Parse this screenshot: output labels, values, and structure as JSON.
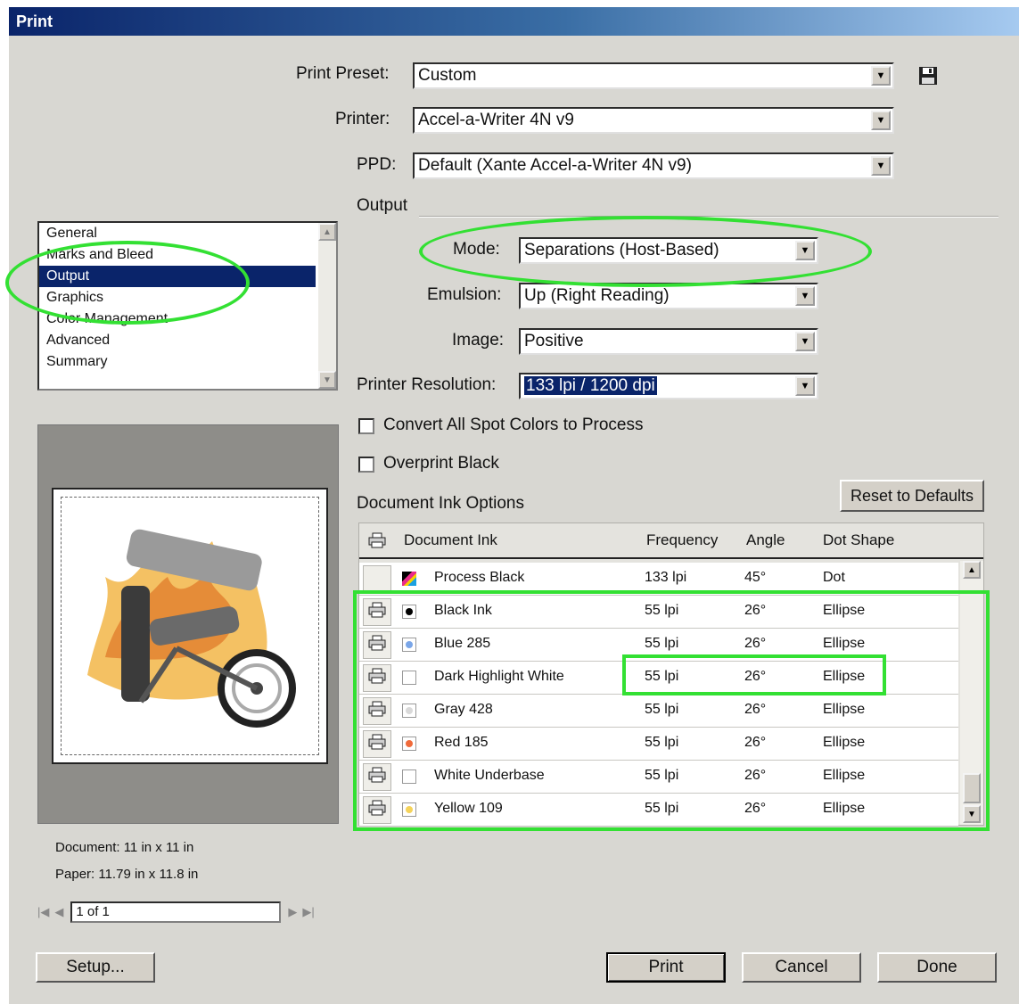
{
  "window": {
    "title": "Print"
  },
  "preset": {
    "label": "Print Preset:",
    "value": "Custom"
  },
  "printer": {
    "label": "Printer:",
    "value": "Accel-a-Writer 4N v9"
  },
  "ppd": {
    "label": "PPD:",
    "value": "Default (Xante Accel-a-Writer 4N v9)"
  },
  "output": {
    "section_title": "Output",
    "mode": {
      "label": "Mode:",
      "value": "Separations (Host-Based)"
    },
    "emulsion": {
      "label": "Emulsion:",
      "value": "Up (Right Reading)"
    },
    "image": {
      "label": "Image:",
      "value": "Positive"
    },
    "resolution": {
      "label": "Printer Resolution:",
      "value": "133 lpi / 1200 dpi"
    },
    "convert_spot": {
      "label": "Convert All Spot Colors to Process",
      "checked": false
    },
    "overprint_black": {
      "label": "Overprint Black",
      "checked": false
    }
  },
  "categories": {
    "items": [
      {
        "label": "General"
      },
      {
        "label": "Marks and Bleed"
      },
      {
        "label": "Output"
      },
      {
        "label": "Graphics"
      },
      {
        "label": "Color Management"
      },
      {
        "label": "Advanced"
      },
      {
        "label": "Summary"
      }
    ],
    "selected": "Output"
  },
  "preview": {
    "document_size": "Document: 11 in x 11 in",
    "paper_size": "Paper: 11.79 in x 11.8 in",
    "page_field": "1 of 1"
  },
  "ink_options": {
    "section_title": "Document Ink Options",
    "reset_label": "Reset to Defaults",
    "columns": {
      "ink": "Document Ink",
      "frequency": "Frequency",
      "angle": "Angle",
      "dot_shape": "Dot Shape"
    },
    "rows": [
      {
        "name": "Process Black",
        "frequency": "133 lpi",
        "angle": "45°",
        "dot_shape": "Dot",
        "swatch": "process",
        "print": false
      },
      {
        "name": "Black Ink",
        "frequency": "55 lpi",
        "angle": "26°",
        "dot_shape": "Ellipse",
        "swatch": "#000000",
        "print": true
      },
      {
        "name": "Blue 285",
        "frequency": "55 lpi",
        "angle": "26°",
        "dot_shape": "Ellipse",
        "swatch": "#7aa6e8",
        "print": true
      },
      {
        "name": "Dark Highlight White",
        "frequency": "55 lpi",
        "angle": "26°",
        "dot_shape": "Ellipse",
        "swatch": "#ffffff",
        "print": true
      },
      {
        "name": "Gray 428",
        "frequency": "55 lpi",
        "angle": "26°",
        "dot_shape": "Ellipse",
        "swatch": "#d9d9d9",
        "print": true
      },
      {
        "name": "Red 185",
        "frequency": "55 lpi",
        "angle": "26°",
        "dot_shape": "Ellipse",
        "swatch": "#f06a3a",
        "print": true
      },
      {
        "name": "White Underbase",
        "frequency": "55 lpi",
        "angle": "26°",
        "dot_shape": "Ellipse",
        "swatch": "#ffffff",
        "print": true
      },
      {
        "name": "Yellow 109",
        "frequency": "55 lpi",
        "angle": "26°",
        "dot_shape": "Ellipse",
        "swatch": "#f5d35a",
        "print": true
      }
    ]
  },
  "buttons": {
    "setup": "Setup...",
    "print": "Print",
    "cancel": "Cancel",
    "done": "Done"
  },
  "colors": {
    "titlebar": "#0a246a",
    "selection": "#0a246a",
    "highlight": "#33e033",
    "dialog_bg": "#d8d7d2"
  }
}
